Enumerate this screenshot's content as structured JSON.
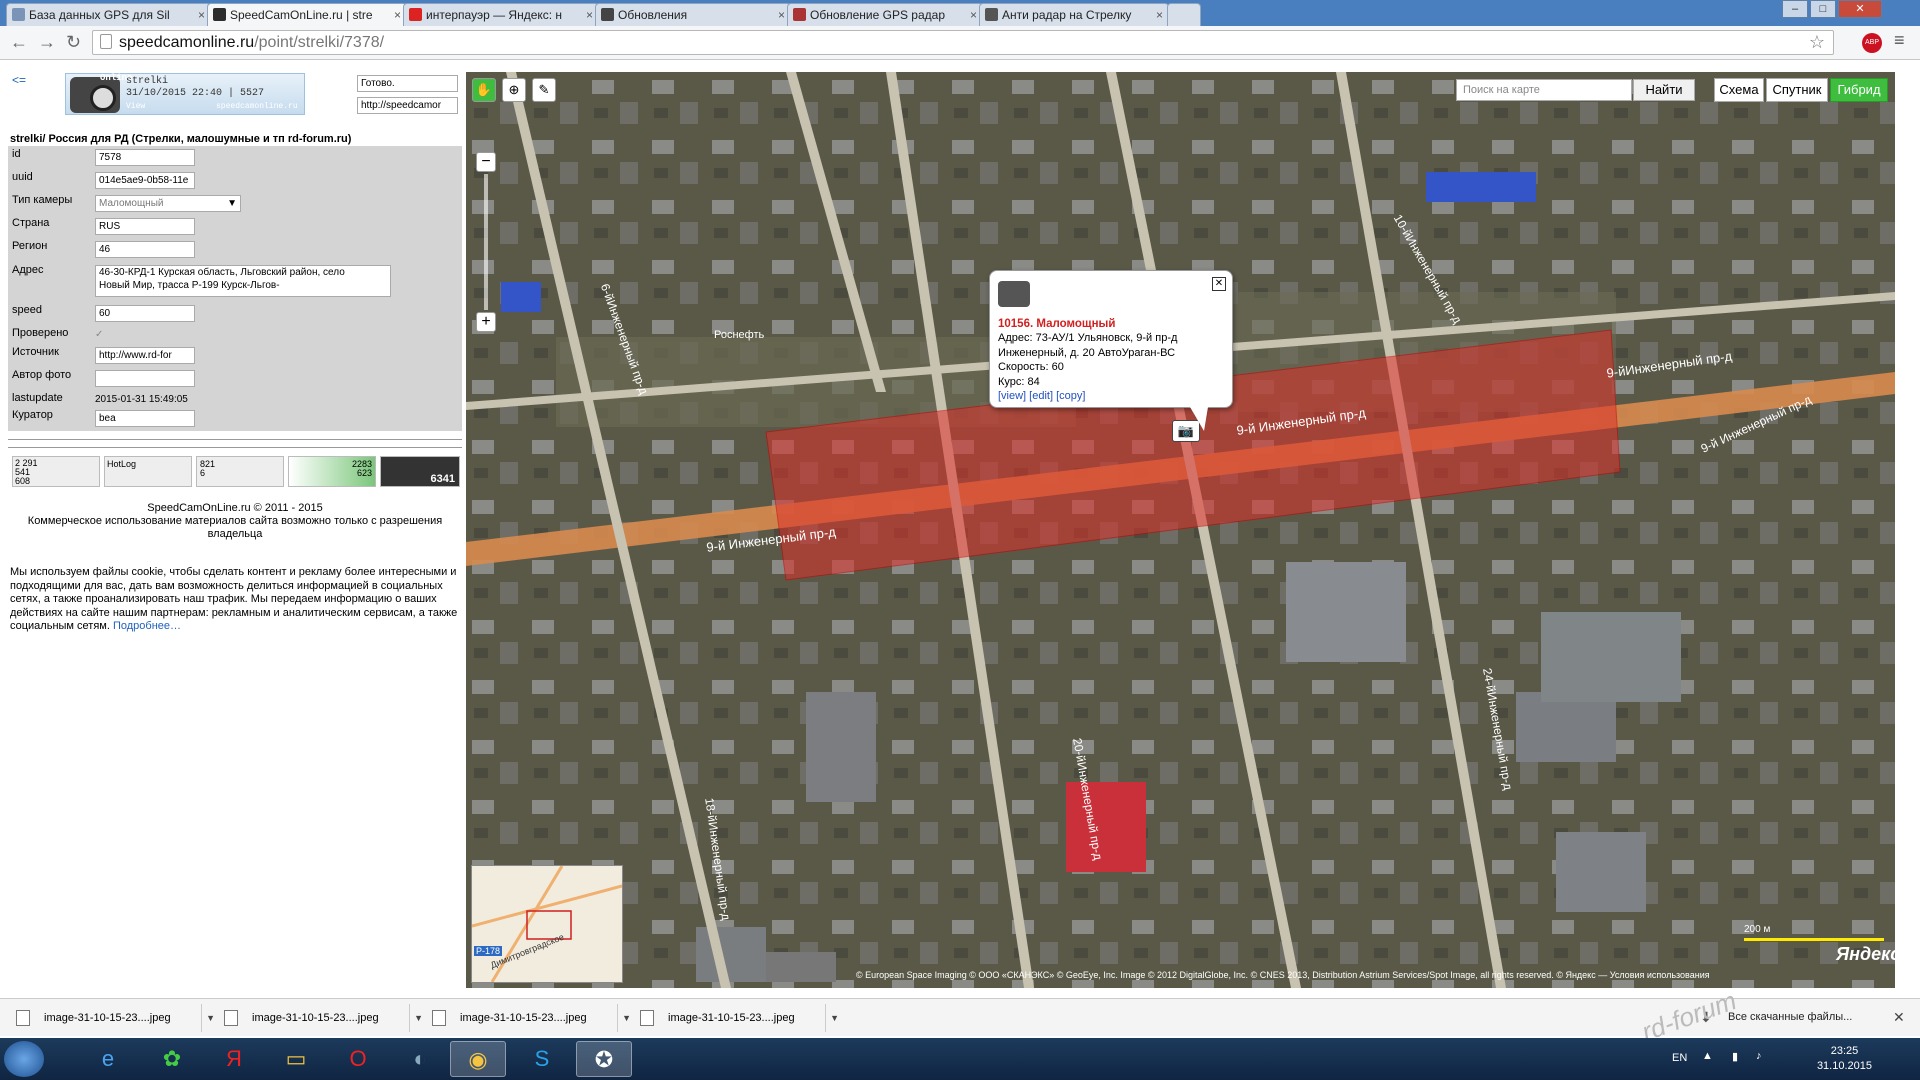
{
  "browser": {
    "tabs": [
      {
        "label": "База данных GPS для Sil",
        "fav": "#7a94b8"
      },
      {
        "label": "SpeedCamOnLine.ru | stre",
        "fav": "#2d2d2d",
        "active": true
      },
      {
        "label": "интерпауэр — Яндекс: н",
        "fav": "#d22"
      },
      {
        "label": "Обновления",
        "fav": "#444"
      },
      {
        "label": "Обновление GPS радар",
        "fav": "#a33"
      },
      {
        "label": "Анти радар на Стрелку",
        "fav": "#555"
      }
    ],
    "url_host": "speedcamonline.ru",
    "url_path": "/point/strelki/7378/",
    "window_buttons": [
      "–",
      "□",
      "✕"
    ]
  },
  "left": {
    "back": "<=",
    "logo": {
      "line1": "strelki",
      "line2": "31/10/2015 22:40 | 5527",
      "brand": "Online",
      "view": "View",
      "site": "speedcamonline.ru"
    },
    "status": "Готово.",
    "link": "http://speedcamor",
    "title": "strelki/ Россия для РД (Стрелки, малошумные и тп rd-forum.ru)",
    "fields": [
      {
        "label": "id",
        "value": "7578"
      },
      {
        "label": "uuid",
        "value": "014e5ae9-0b58-11e"
      },
      {
        "label": "Тип камеры",
        "value": "Маломощный"
      },
      {
        "label": "Страна",
        "value": "RUS"
      },
      {
        "label": "Регион",
        "value": "46"
      },
      {
        "label": "Адрес",
        "value": "46-30-КРД-1 Курская область, Льговский район, село Новый Мир, трасса Р-199 Курск-Льгов-"
      },
      {
        "label": "speed",
        "value": "60"
      },
      {
        "label": "Проверено",
        "value": "✓"
      },
      {
        "label": "Источник",
        "value": "http://www.rd-for"
      },
      {
        "label": "Автор фото",
        "value": ""
      },
      {
        "label": "lastupdate",
        "value": "2015-01-31 15:49:05"
      },
      {
        "label": "Куратор",
        "value": "bea"
      }
    ],
    "counters": [
      "2 291\n541\n608",
      "HotLog",
      "821\n6",
      "",
      "2283\n623",
      "6341"
    ],
    "copyright": "SpeedCamOnLine.ru © 2011 - 2015",
    "copyright2": "Коммерческое использование материалов сайта возможно только с разрешения владельца",
    "cookie": "Мы используем файлы cookie, чтобы сделать контент и рекламу более интересными и подходящими для вас, дать вам возможность делиться информацией в социальных сетях, а также проанализировать наш трафик. Мы передаем информацию о ваших действиях на сайте нашим партнерам: рекламным и аналитическим сервисам, а также социальным сетям.",
    "cookie_link": "Подробнее…"
  },
  "map": {
    "search_placeholder": "Поиск на карте",
    "find": "Найти",
    "layers": [
      {
        "label": "Схема"
      },
      {
        "label": "Спутник"
      },
      {
        "label": "Гибрид",
        "on": true
      }
    ],
    "streets": [
      "9-йИнженерный пр-д",
      "9-й Инженерный пр-д",
      "9-й Инженерный пр-д",
      "9-й Инженерный пр-д",
      "10-йИнженерный пр-д",
      "6-йИнженерный пр-д",
      "18-йИнженерный пр-д",
      "20-йИнженерный пр-д",
      "24-йИнженерный пр-д",
      "Роснефть",
      "Р-178",
      "Димитровградское"
    ],
    "popup": {
      "title": "10156. Маломощный",
      "addr1": "Адрес: 73-АУ/1 Ульяновск, 9-й пр-д",
      "addr2": "Инженерный, д. 20 АвтоУраган-ВС",
      "speed": "Скорость: 60",
      "course": "Курс: 84",
      "links": "[view] [edit] [copy]"
    },
    "scale": "200 м",
    "yandex": "Яндекс",
    "copyright": "© European Space Imaging © ООО «СКАНЭКС» © GeoEye, Inc. Image © 2012 DigitalGlobe, Inc. © CNES 2013, Distribution Astrium Services/Spot Image, all rights reserved. © Яндекс — Условия использования"
  },
  "downloads": {
    "items": [
      "image-31-10-15-23....jpeg",
      "image-31-10-15-23....jpeg",
      "image-31-10-15-23....jpeg",
      "image-31-10-15-23....jpeg"
    ],
    "all": "Все скачанные файлы..."
  },
  "taskbar": {
    "lang": "EN",
    "time": "23:25",
    "date": "31.10.2015",
    "watermark": "rd-forum"
  }
}
